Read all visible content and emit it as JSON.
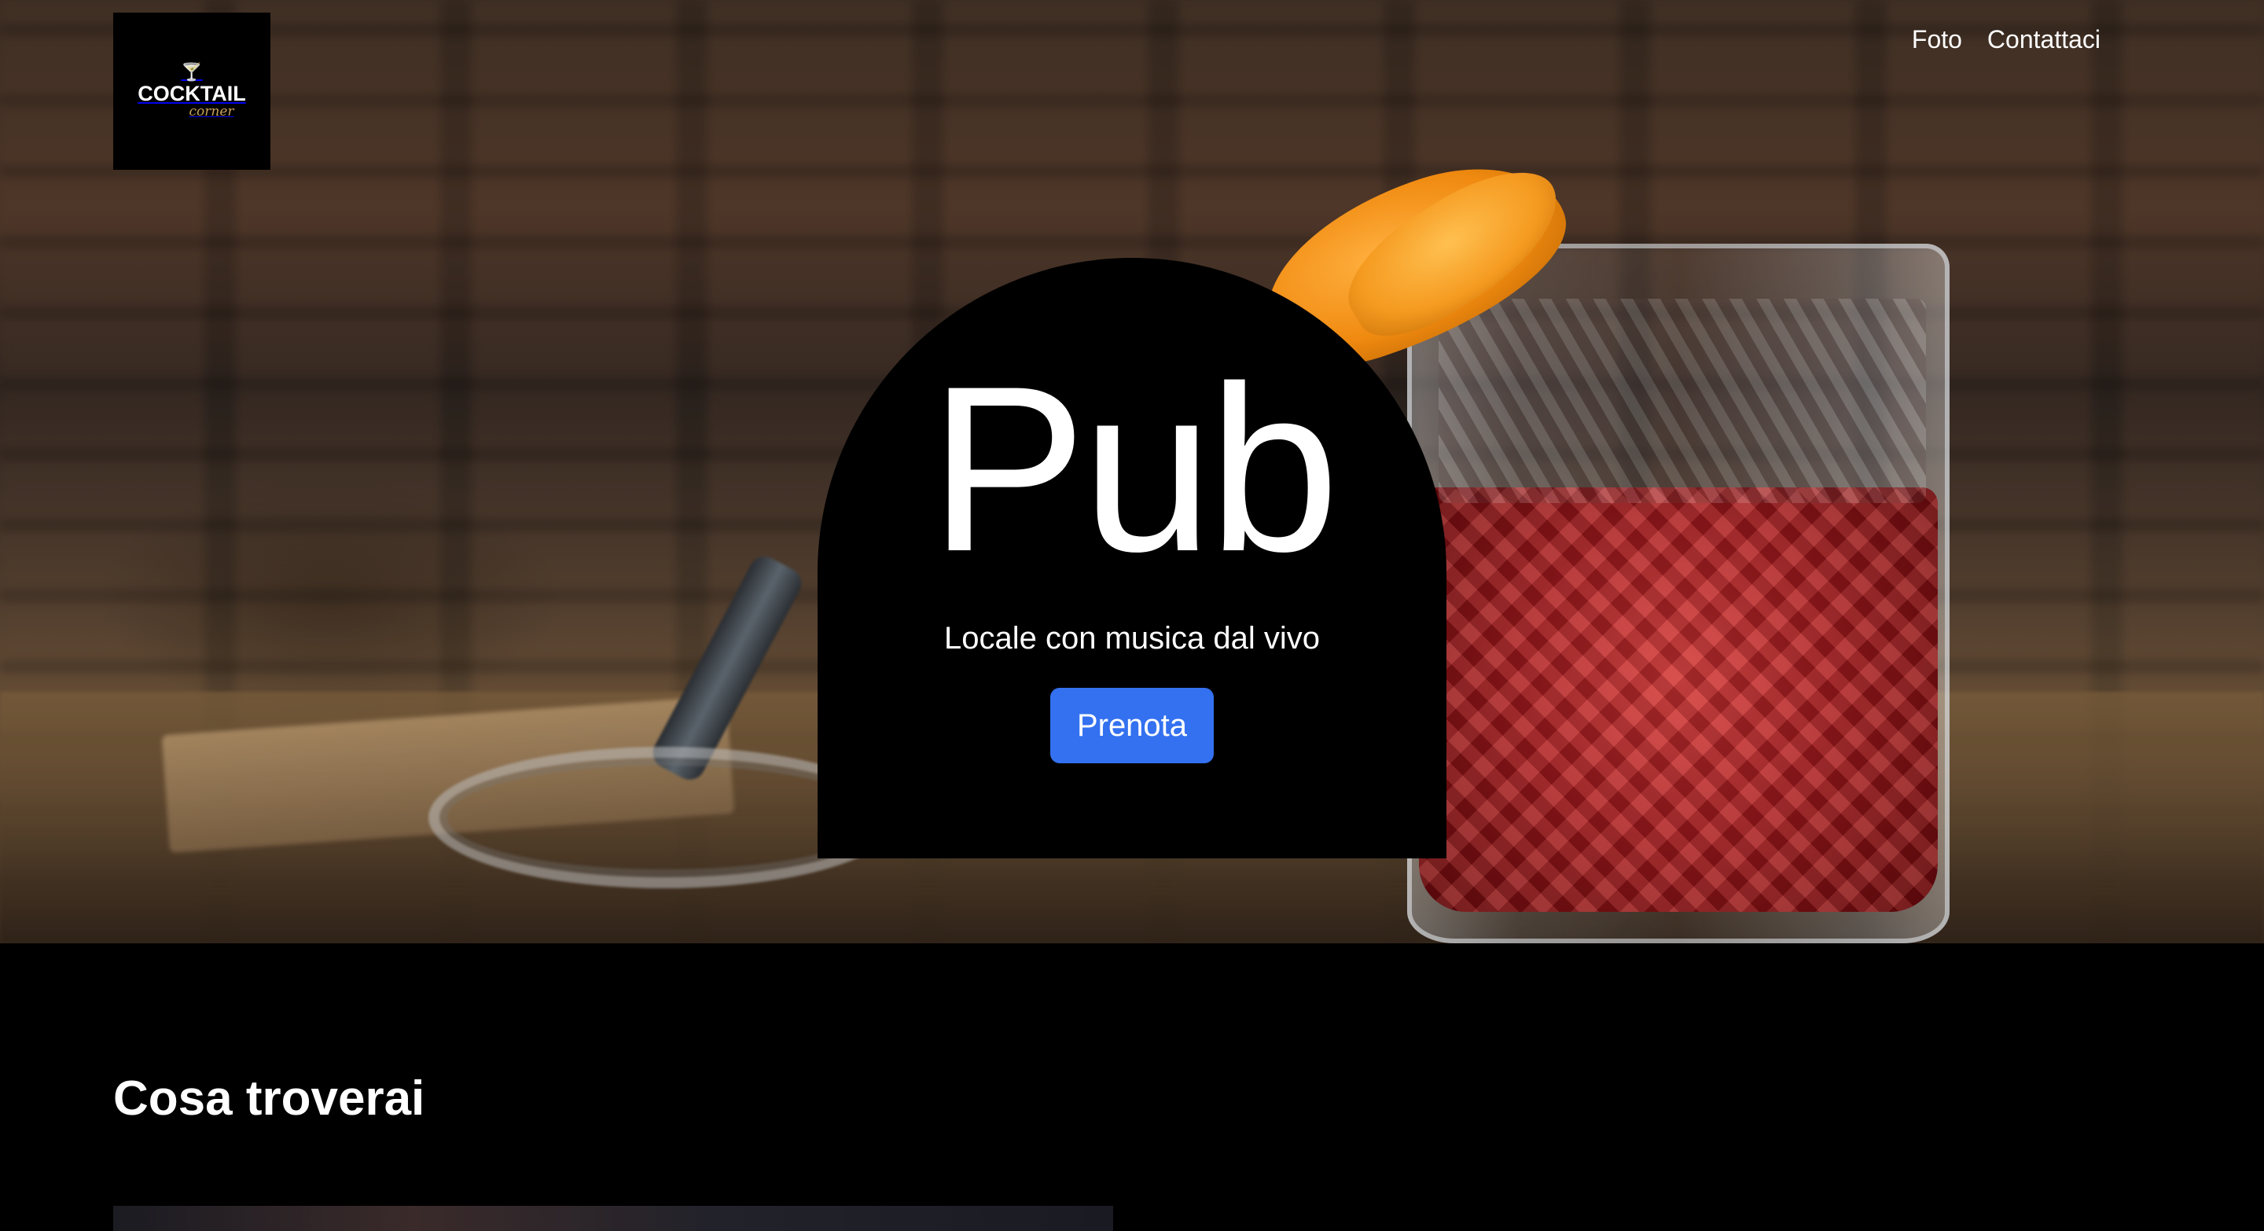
{
  "logo": {
    "text_main": "COCKTAIL",
    "text_sub": "corner",
    "icon": "cocktail-glass-icon"
  },
  "nav": {
    "items": [
      {
        "label": "Foto"
      },
      {
        "label": "Contattaci"
      }
    ]
  },
  "hero": {
    "title": "Pub",
    "subtitle": "Locale con musica dal vivo",
    "cta_label": "Prenota",
    "accent_color": "#3471f0"
  },
  "section": {
    "title": "Cosa troverai"
  }
}
